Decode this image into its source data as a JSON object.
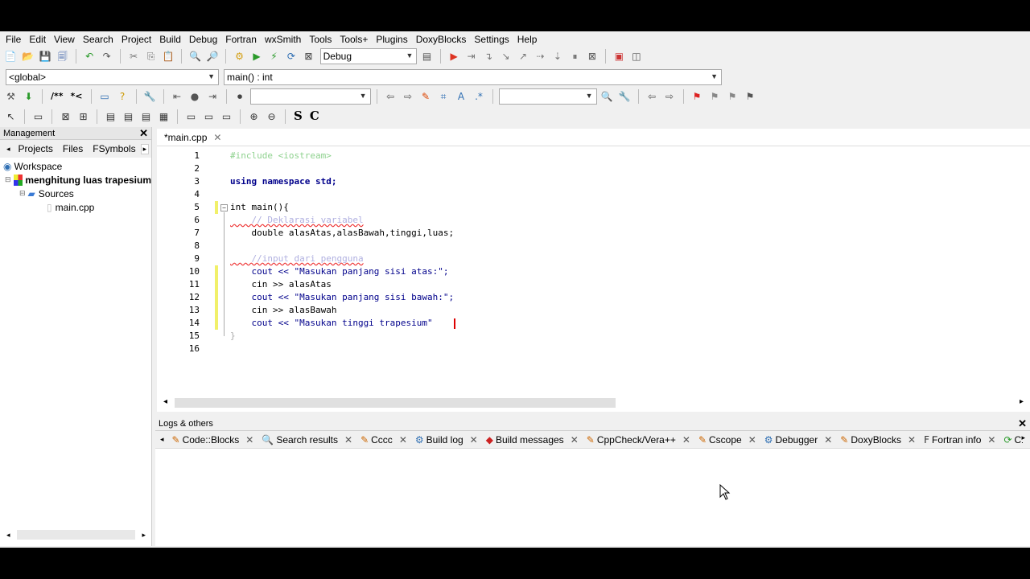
{
  "menubar": [
    "File",
    "Edit",
    "View",
    "Search",
    "Project",
    "Build",
    "Debug",
    "Fortran",
    "wxSmith",
    "Tools",
    "Tools+",
    "Plugins",
    "DoxyBlocks",
    "Settings",
    "Help"
  ],
  "toolbar1": {
    "build_target": "Debug"
  },
  "toolbar2": {
    "scope": "<global>",
    "function": "main() : int"
  },
  "toolbar3": {
    "comment_btn": "/**",
    "uncomment_btn": "*<",
    "style_s": "S",
    "style_c": "C"
  },
  "management": {
    "title": "Management",
    "tabs": [
      "Projects",
      "Files",
      "FSymbols"
    ],
    "tree": {
      "workspace": "Workspace",
      "project": "menghitung luas trapesium",
      "sources": "Sources",
      "file": "main.cpp"
    }
  },
  "editor": {
    "tab_label": "*main.cpp",
    "lines": [
      {
        "n": "1",
        "t": "#include <iostream>"
      },
      {
        "n": "2",
        "t": ""
      },
      {
        "n": "3",
        "t": "using namespace std;"
      },
      {
        "n": "4",
        "t": ""
      },
      {
        "n": "5",
        "t": "int main(){"
      },
      {
        "n": "6",
        "t": "    // Deklarasi variabel"
      },
      {
        "n": "7",
        "t": "    double alasAtas,alasBawah,tinggi,luas;"
      },
      {
        "n": "8",
        "t": ""
      },
      {
        "n": "9",
        "t": "    //input dari pengguna"
      },
      {
        "n": "10",
        "t": "    cout << \"Masukan panjang sisi atas:\";"
      },
      {
        "n": "11",
        "t": "    cin >> alasAtas"
      },
      {
        "n": "12",
        "t": "    cout << \"Masukan panjang sisi bawah:\";"
      },
      {
        "n": "13",
        "t": "    cin >> alasBawah"
      },
      {
        "n": "14",
        "t": "    cout << \"Masukan tinggi trapesium\""
      },
      {
        "n": "15",
        "t": "}"
      },
      {
        "n": "16",
        "t": ""
      }
    ]
  },
  "logs": {
    "title": "Logs & others",
    "tabs": [
      "Code::Blocks",
      "Search results",
      "Cccc",
      "Build log",
      "Build messages",
      "CppCheck/Vera++",
      "Cscope",
      "Debugger",
      "DoxyBlocks",
      "Fortran info",
      "Cl"
    ]
  }
}
